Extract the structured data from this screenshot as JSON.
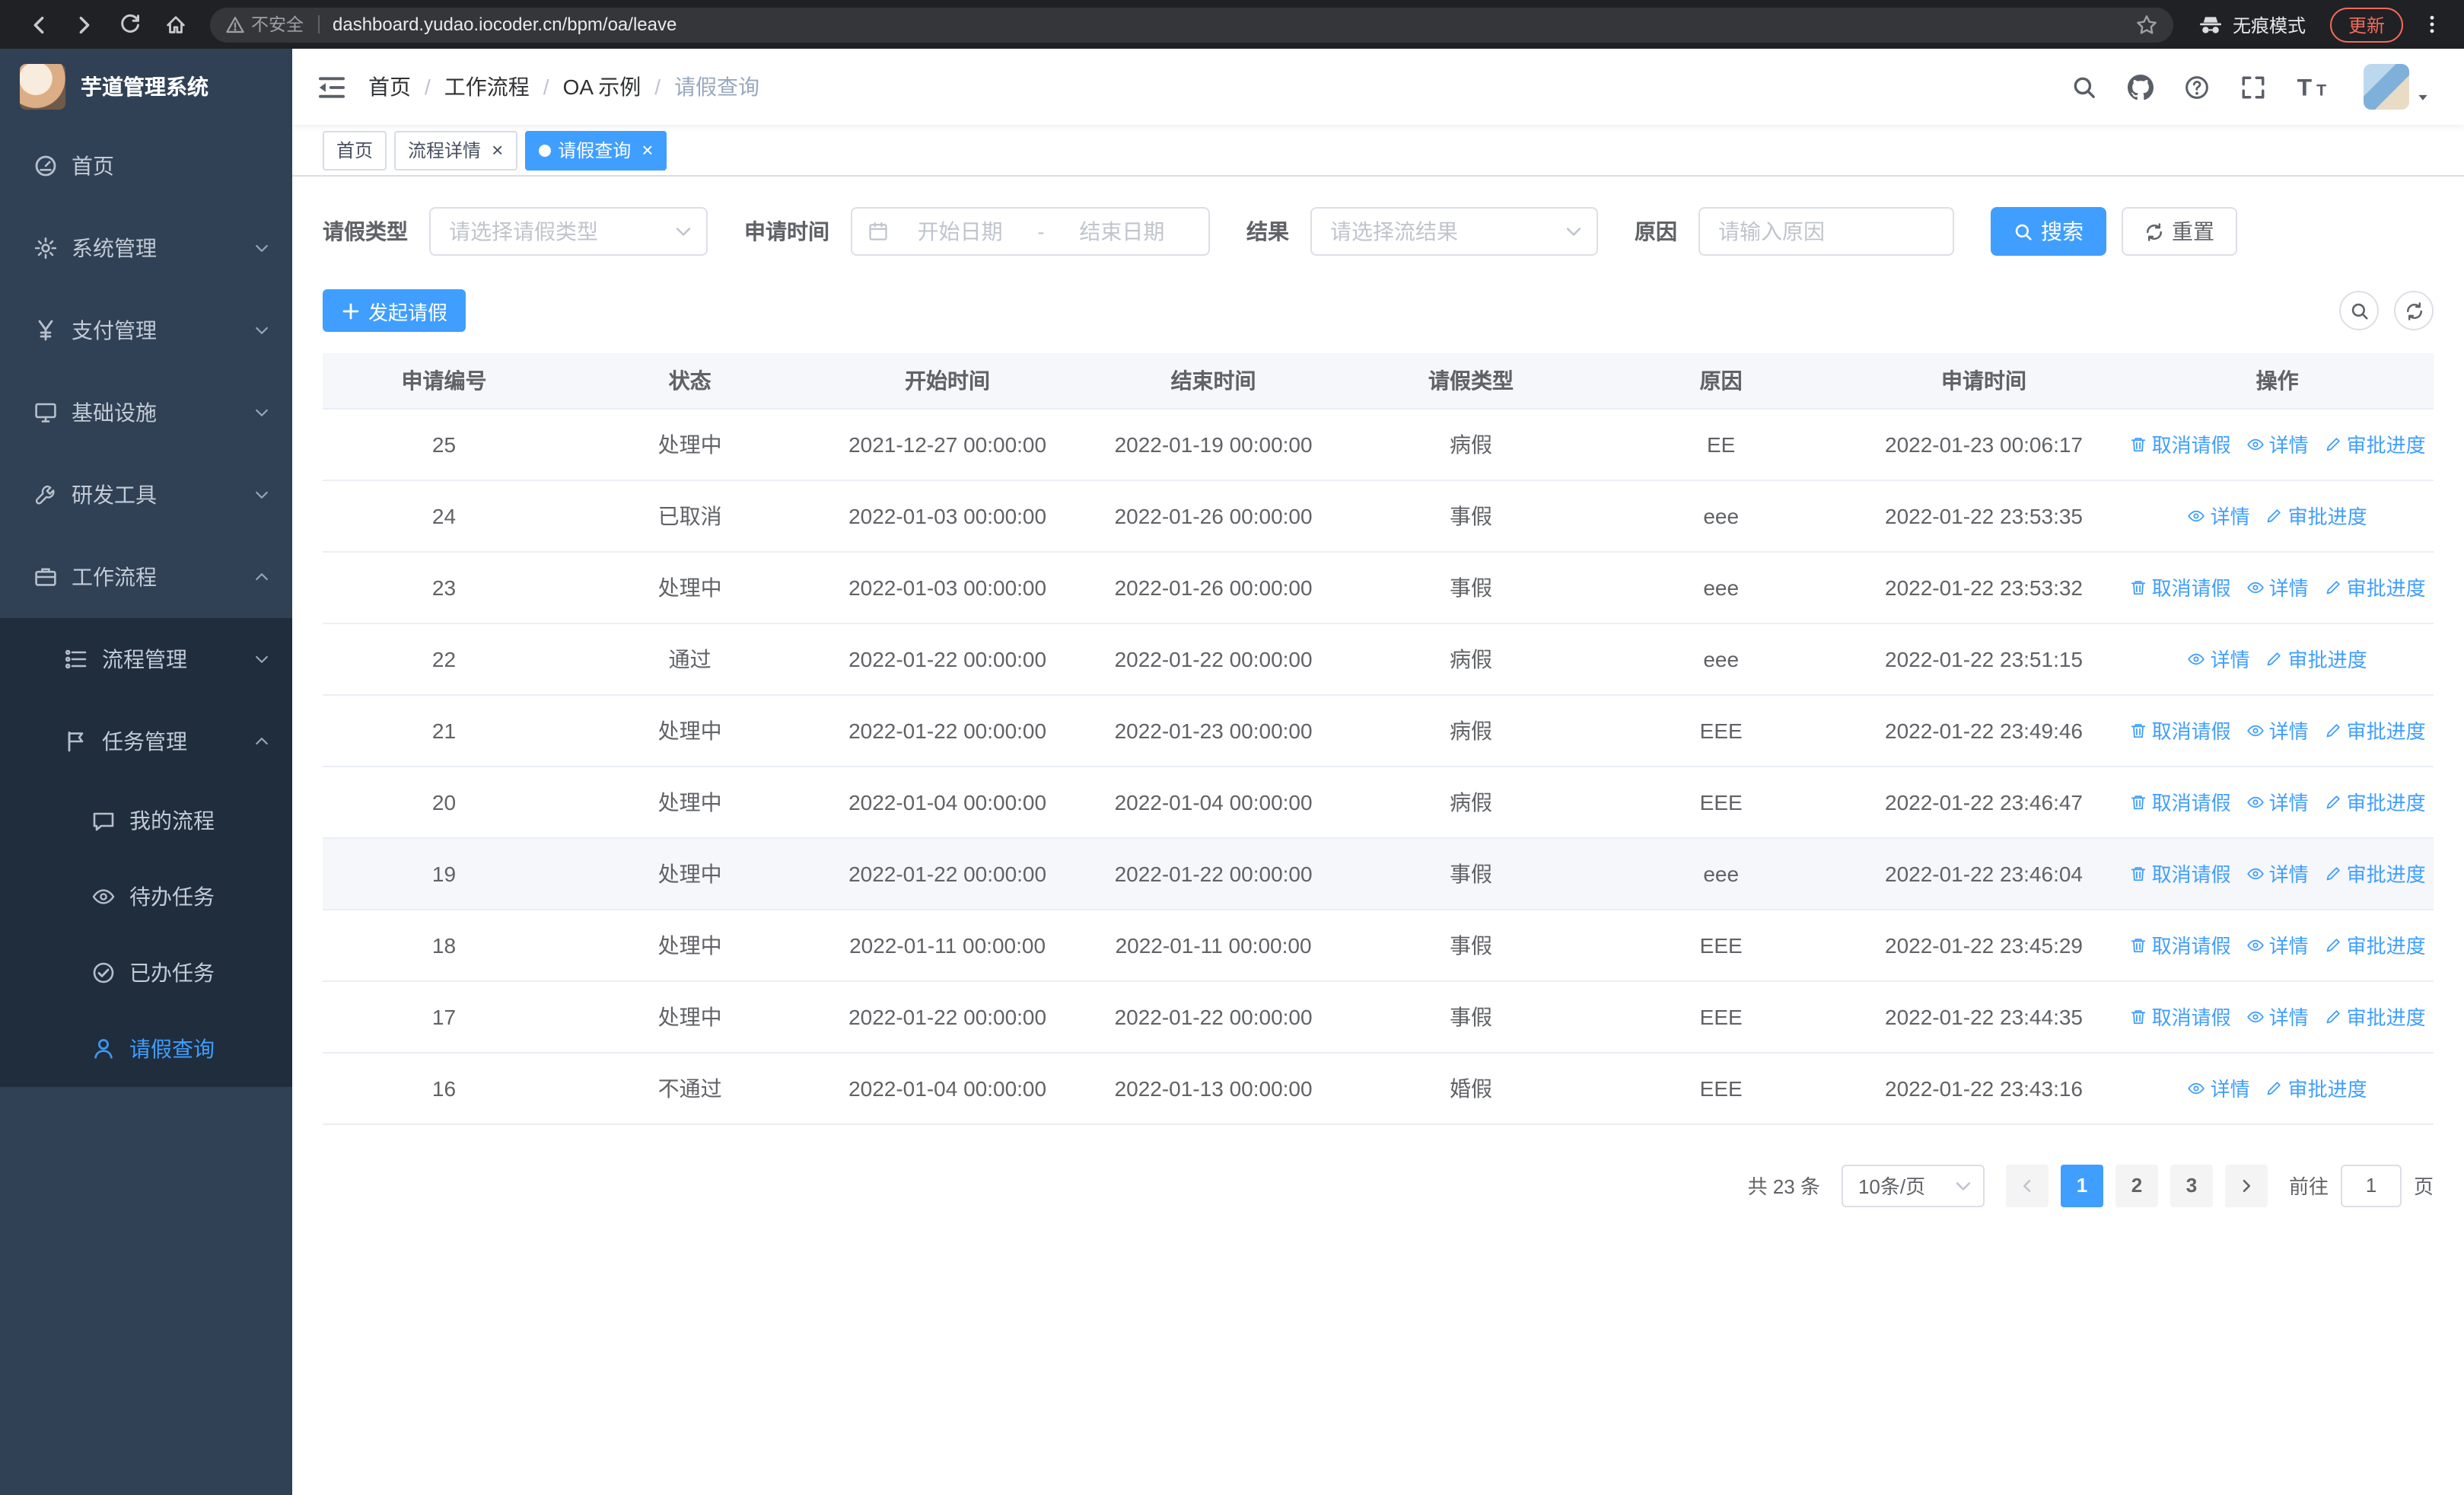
{
  "colors": {
    "accent": "#409eff",
    "sidebar_bg": "#304156",
    "submenu_bg": "#1f2d3d",
    "chrome_bg": "#202124",
    "table_header_bg": "#f5f7fa",
    "update_badge": "#f3695a"
  },
  "browser": {
    "security_label": "不安全",
    "url": "dashboard.yudao.iocoder.cn/bpm/oa/leave",
    "incognito_label": "无痕模式",
    "update_label": "更新"
  },
  "sidebar": {
    "logo_title": "芋道管理系统",
    "items": [
      {
        "label": "首页",
        "icon": "dashboard",
        "level": 0
      },
      {
        "label": "系统管理",
        "icon": "gear",
        "level": 0,
        "chevron": "down"
      },
      {
        "label": "支付管理",
        "icon": "yen",
        "level": 0,
        "chevron": "down"
      },
      {
        "label": "基础设施",
        "icon": "monitor",
        "level": 0,
        "chevron": "down"
      },
      {
        "label": "研发工具",
        "icon": "tools",
        "level": 0,
        "chevron": "down"
      },
      {
        "label": "工作流程",
        "icon": "briefcase",
        "level": 0,
        "chevron": "up"
      },
      {
        "label": "流程管理",
        "icon": "tree-list",
        "level": 1,
        "chevron": "down"
      },
      {
        "label": "任务管理",
        "icon": "flag",
        "level": 1,
        "chevron": "up"
      },
      {
        "label": "我的流程",
        "icon": "chat",
        "level": 2
      },
      {
        "label": "待办任务",
        "icon": "eye",
        "level": 2
      },
      {
        "label": "已办任务",
        "icon": "check-circle",
        "level": 2
      },
      {
        "label": "请假查询",
        "icon": "user",
        "level": 2,
        "active": true
      }
    ]
  },
  "header": {
    "breadcrumb": [
      "首页",
      "工作流程",
      "OA 示例",
      "请假查询"
    ]
  },
  "tabs": [
    {
      "label": "首页",
      "closable": false,
      "active": false
    },
    {
      "label": "流程详情",
      "closable": true,
      "active": false
    },
    {
      "label": "请假查询",
      "closable": true,
      "active": true
    }
  ],
  "filters": {
    "leave_type": {
      "label": "请假类型",
      "placeholder": "请选择请假类型"
    },
    "apply_time": {
      "label": "申请时间",
      "start_placeholder": "开始日期",
      "separator": "-",
      "end_placeholder": "结束日期"
    },
    "result": {
      "label": "结果",
      "placeholder": "请选择流结果"
    },
    "reason": {
      "label": "原因",
      "placeholder": "请输入原因"
    },
    "search_label": "搜索",
    "reset_label": "重置"
  },
  "toolbar": {
    "create_label": "发起请假"
  },
  "table": {
    "columns": [
      "申请编号",
      "状态",
      "开始时间",
      "结束时间",
      "请假类型",
      "原因",
      "申请时间",
      "操作"
    ],
    "rows": [
      {
        "id": "25",
        "status": "处理中",
        "start": "2021-12-27 00:00:00",
        "end": "2022-01-19 00:00:00",
        "type": "病假",
        "reason": "EE",
        "applied": "2022-01-23 00:06:17",
        "actions": [
          {
            "label": "取消请假",
            "icon": "delete"
          },
          {
            "label": "详情",
            "icon": "eye"
          },
          {
            "label": "审批进度",
            "icon": "edit"
          }
        ]
      },
      {
        "id": "24",
        "status": "已取消",
        "start": "2022-01-03 00:00:00",
        "end": "2022-01-26 00:00:00",
        "type": "事假",
        "reason": "eee",
        "applied": "2022-01-22 23:53:35",
        "actions": [
          {
            "label": "详情",
            "icon": "eye"
          },
          {
            "label": "审批进度",
            "icon": "edit"
          }
        ]
      },
      {
        "id": "23",
        "status": "处理中",
        "start": "2022-01-03 00:00:00",
        "end": "2022-01-26 00:00:00",
        "type": "事假",
        "reason": "eee",
        "applied": "2022-01-22 23:53:32",
        "actions": [
          {
            "label": "取消请假",
            "icon": "delete"
          },
          {
            "label": "详情",
            "icon": "eye"
          },
          {
            "label": "审批进度",
            "icon": "edit"
          }
        ]
      },
      {
        "id": "22",
        "status": "通过",
        "start": "2022-01-22 00:00:00",
        "end": "2022-01-22 00:00:00",
        "type": "病假",
        "reason": "eee",
        "applied": "2022-01-22 23:51:15",
        "actions": [
          {
            "label": "详情",
            "icon": "eye"
          },
          {
            "label": "审批进度",
            "icon": "edit"
          }
        ]
      },
      {
        "id": "21",
        "status": "处理中",
        "start": "2022-01-22 00:00:00",
        "end": "2022-01-23 00:00:00",
        "type": "病假",
        "reason": "EEE",
        "applied": "2022-01-22 23:49:46",
        "actions": [
          {
            "label": "取消请假",
            "icon": "delete"
          },
          {
            "label": "详情",
            "icon": "eye"
          },
          {
            "label": "审批进度",
            "icon": "edit"
          }
        ]
      },
      {
        "id": "20",
        "status": "处理中",
        "start": "2022-01-04 00:00:00",
        "end": "2022-01-04 00:00:00",
        "type": "病假",
        "reason": "EEE",
        "applied": "2022-01-22 23:46:47",
        "actions": [
          {
            "label": "取消请假",
            "icon": "delete"
          },
          {
            "label": "详情",
            "icon": "eye"
          },
          {
            "label": "审批进度",
            "icon": "edit"
          }
        ]
      },
      {
        "id": "19",
        "status": "处理中",
        "start": "2022-01-22 00:00:00",
        "end": "2022-01-22 00:00:00",
        "type": "事假",
        "reason": "eee",
        "applied": "2022-01-22 23:46:04",
        "highlighted": true,
        "actions": [
          {
            "label": "取消请假",
            "icon": "delete"
          },
          {
            "label": "详情",
            "icon": "eye"
          },
          {
            "label": "审批进度",
            "icon": "edit"
          }
        ]
      },
      {
        "id": "18",
        "status": "处理中",
        "start": "2022-01-11 00:00:00",
        "end": "2022-01-11 00:00:00",
        "type": "事假",
        "reason": "EEE",
        "applied": "2022-01-22 23:45:29",
        "actions": [
          {
            "label": "取消请假",
            "icon": "delete"
          },
          {
            "label": "详情",
            "icon": "eye"
          },
          {
            "label": "审批进度",
            "icon": "edit"
          }
        ]
      },
      {
        "id": "17",
        "status": "处理中",
        "start": "2022-01-22 00:00:00",
        "end": "2022-01-22 00:00:00",
        "type": "事假",
        "reason": "EEE",
        "applied": "2022-01-22 23:44:35",
        "actions": [
          {
            "label": "取消请假",
            "icon": "delete"
          },
          {
            "label": "详情",
            "icon": "eye"
          },
          {
            "label": "审批进度",
            "icon": "edit"
          }
        ]
      },
      {
        "id": "16",
        "status": "不通过",
        "start": "2022-01-04 00:00:00",
        "end": "2022-01-13 00:00:00",
        "type": "婚假",
        "reason": "EEE",
        "applied": "2022-01-22 23:43:16",
        "actions": [
          {
            "label": "详情",
            "icon": "eye"
          },
          {
            "label": "审批进度",
            "icon": "edit"
          }
        ]
      }
    ]
  },
  "pagination": {
    "total_label": "共 23 条",
    "page_size": "10条/页",
    "pages": [
      "1",
      "2",
      "3"
    ],
    "active_page": "1",
    "goto_label": "前往",
    "goto_value": "1",
    "goto_suffix": "页"
  }
}
